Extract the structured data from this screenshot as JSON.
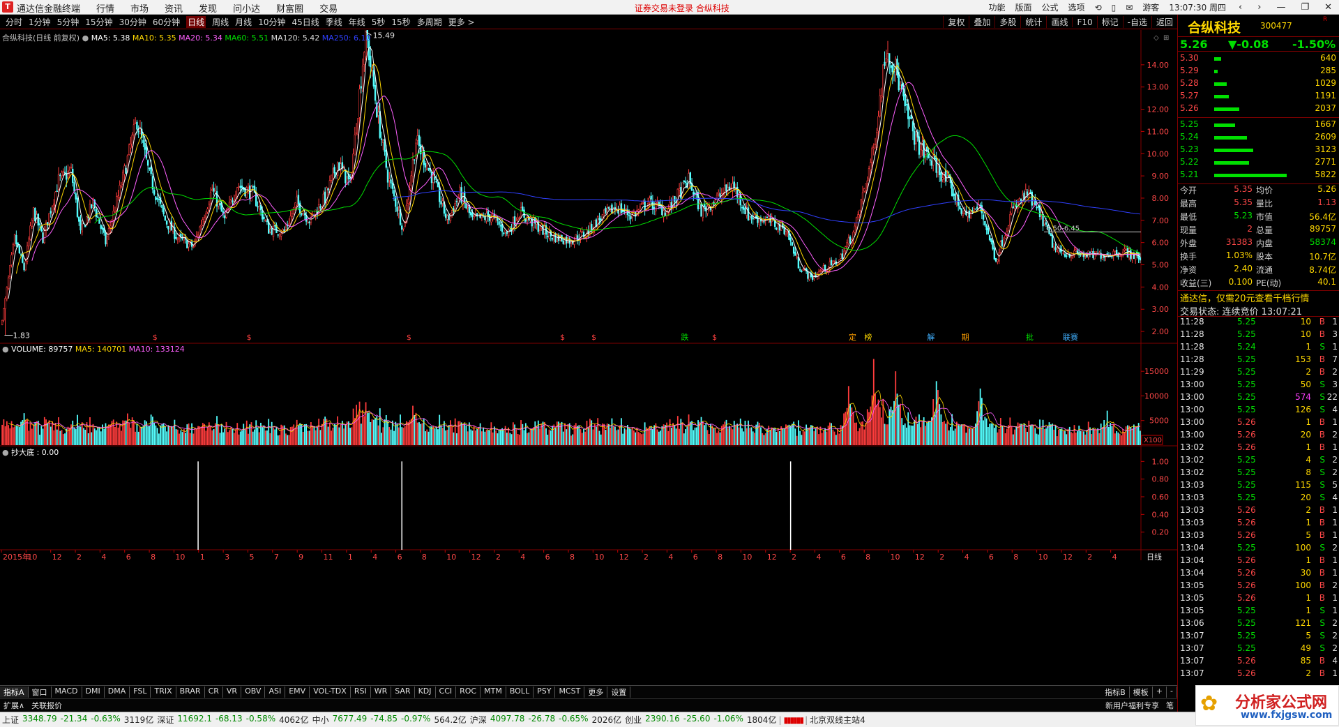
{
  "window": {
    "title": "通达信金融终端",
    "notice": "证券交易未登录  合纵科技",
    "logo_char": "T"
  },
  "menu": [
    "行情",
    "市场",
    "资讯",
    "发现",
    "问小达",
    "财富圈",
    "交易"
  ],
  "titlebar_right": [
    "功能",
    "版面",
    "公式",
    "选项",
    "游客",
    "13:07:30 周四"
  ],
  "periods": [
    "分时",
    "1分钟",
    "5分钟",
    "15分钟",
    "30分钟",
    "60分钟",
    "日线",
    "周线",
    "月线",
    "10分钟",
    "45日线",
    "季线",
    "年线",
    "5秒",
    "15秒",
    "多周期",
    "更多 >"
  ],
  "active_period": "日线",
  "tools": [
    "复权",
    "叠加",
    "多股",
    "统计",
    "画线",
    "F10",
    "标记",
    "-自选",
    "返回"
  ],
  "legend_main": {
    "symbol": "合纵科技(日线 前复权)",
    "ma5": "MA5: 5.38",
    "ma10": "MA10: 5.35",
    "ma20": "MA20: 5.34",
    "ma60": "MA60: 5.51",
    "ma120": "MA120: 5.42",
    "ma250": "MA250: 6.10"
  },
  "legend_vol": {
    "vol": "VOLUME: 89757",
    "ma5": "MA5: 140701",
    "ma10": "MA10: 133124"
  },
  "legend_ind": {
    "name": "抄大底 : 0.00"
  },
  "colors": {
    "up": "#ff3c3c",
    "down": "#54ffff",
    "ma5": "#ffffff",
    "ma10": "#ffd800",
    "ma20": "#ff60ff",
    "ma60": "#00e000",
    "ma250": "#3040ff",
    "grid": "#800000",
    "panel_border": "#800000"
  },
  "chart_data": [
    {
      "type": "candlestick",
      "title": "合纵科技(日线 前复权)",
      "y_ticks": [
        2.0,
        3.0,
        4.0,
        5.0,
        6.0,
        7.0,
        8.0,
        9.0,
        10.0,
        11.0,
        12.0,
        13.0,
        14.0
      ],
      "ylim": [
        1.5,
        15.0
      ],
      "high_label": "15.49",
      "low_label": "1.83",
      "annotation": "6.50-6.45",
      "close_path": [
        [
          0,
          2.5
        ],
        [
          8,
          6.2
        ],
        [
          14,
          4.8
        ],
        [
          20,
          7.4
        ],
        [
          26,
          6.2
        ],
        [
          36,
          8.8
        ],
        [
          44,
          9.2
        ],
        [
          50,
          6.4
        ],
        [
          58,
          7.8
        ],
        [
          66,
          6.0
        ],
        [
          76,
          8.6
        ],
        [
          86,
          11.5
        ],
        [
          94,
          9.0
        ],
        [
          104,
          7.0
        ],
        [
          112,
          6.2
        ],
        [
          122,
          5.8
        ],
        [
          134,
          8.4
        ],
        [
          142,
          7.0
        ],
        [
          150,
          8.6
        ],
        [
          160,
          8.2
        ],
        [
          170,
          6.6
        ],
        [
          180,
          6.5
        ],
        [
          188,
          7.8
        ],
        [
          196,
          7.0
        ],
        [
          206,
          8.0
        ],
        [
          214,
          9.6
        ],
        [
          222,
          8.6
        ],
        [
          232,
          15.49
        ],
        [
          240,
          11.5
        ],
        [
          246,
          9.0
        ],
        [
          256,
          6.6
        ],
        [
          264,
          10.6
        ],
        [
          274,
          9.0
        ],
        [
          284,
          7.0
        ],
        [
          292,
          8.2
        ],
        [
          300,
          7.0
        ],
        [
          312,
          7.2
        ],
        [
          322,
          6.4
        ],
        [
          330,
          7.4
        ],
        [
          340,
          6.8
        ],
        [
          350,
          6.3
        ],
        [
          362,
          6.1
        ],
        [
          372,
          6.4
        ],
        [
          380,
          7.0
        ],
        [
          392,
          7.6
        ],
        [
          402,
          7.2
        ],
        [
          412,
          7.8
        ],
        [
          424,
          7.4
        ],
        [
          438,
          8.8
        ],
        [
          446,
          7.4
        ],
        [
          456,
          8.0
        ],
        [
          466,
          8.6
        ],
        [
          476,
          7.2
        ],
        [
          488,
          7.0
        ],
        [
          500,
          6.6
        ],
        [
          508,
          5.0
        ],
        [
          516,
          4.4
        ],
        [
          524,
          4.8
        ],
        [
          534,
          5.2
        ],
        [
          544,
          6.6
        ],
        [
          556,
          10.2
        ],
        [
          564,
          14.8
        ],
        [
          570,
          13.8
        ],
        [
          576,
          12.0
        ],
        [
          584,
          10.4
        ],
        [
          594,
          9.6
        ],
        [
          604,
          8.6
        ],
        [
          614,
          7.2
        ],
        [
          624,
          7.6
        ],
        [
          634,
          5.2
        ],
        [
          644,
          7.4
        ],
        [
          654,
          8.2
        ],
        [
          664,
          7.0
        ],
        [
          672,
          5.6
        ],
        [
          684,
          5.5
        ],
        [
          696,
          5.4
        ],
        [
          706,
          5.5
        ],
        [
          716,
          5.6
        ],
        [
          726,
          5.3
        ]
      ]
    },
    {
      "type": "bar",
      "title": "VOLUME",
      "y_ticks": [
        5000,
        10000,
        15000
      ],
      "ylim": [
        0,
        18000
      ],
      "unit_label": "X100",
      "spikes": [
        [
          14,
          6500
        ],
        [
          95,
          6200
        ],
        [
          226,
          8200
        ],
        [
          262,
          8000
        ],
        [
          540,
          12000
        ],
        [
          556,
          17500
        ],
        [
          570,
          15000
        ],
        [
          596,
          13000
        ],
        [
          624,
          11500
        ],
        [
          705,
          7000
        ]
      ]
    },
    {
      "type": "line",
      "title": "抄大底",
      "y_ticks": [
        0.2,
        0.4,
        0.6,
        0.8,
        1.0
      ],
      "ylim": [
        0,
        1.05
      ],
      "signals": [
        125,
        255,
        503
      ]
    }
  ],
  "x_axis": {
    "labels": [
      "2015年",
      "10",
      "12",
      "2",
      "4",
      "6",
      "8",
      "10",
      "1",
      "3",
      "5",
      "7",
      "9",
      "11",
      "1",
      "4",
      "6",
      "8",
      "10",
      "12",
      "2",
      "4",
      "6",
      "8",
      "10",
      "12",
      "2",
      "4",
      "6",
      "8",
      "10",
      "12",
      "2",
      "4",
      "6",
      "8",
      "10",
      "12",
      "2",
      "4",
      "6",
      "8",
      "10",
      "12",
      "2",
      "4"
    ],
    "period_label": "日线"
  },
  "event_marks": [
    {
      "x": 98,
      "text": "$",
      "c": "#ff4040"
    },
    {
      "x": 158,
      "text": "$",
      "c": "#ff4040"
    },
    {
      "x": 260,
      "text": "$",
      "c": "#ff4040"
    },
    {
      "x": 358,
      "text": "$",
      "c": "#ff4040"
    },
    {
      "x": 378,
      "text": "$",
      "c": "#ff4040"
    },
    {
      "x": 436,
      "text": "跌",
      "c": "#00e000"
    },
    {
      "x": 455,
      "text": "$",
      "c": "#ff4040"
    },
    {
      "x": 543,
      "text": "定",
      "c": "#ffa000"
    },
    {
      "x": 553,
      "text": "榜",
      "c": "#ffd800"
    },
    {
      "x": 593,
      "text": "解",
      "c": "#40b0ff"
    },
    {
      "x": 615,
      "text": "期",
      "c": "#ffa000"
    },
    {
      "x": 656,
      "text": "批",
      "c": "#00e000"
    },
    {
      "x": 682,
      "text": "联赛",
      "c": "#40b0ff"
    }
  ],
  "quote": {
    "name": "合纵科技",
    "code": "300477",
    "r_mark": "R",
    "price": "5.26",
    "change": "▼-0.08",
    "pct": "-1.50%"
  },
  "asks": [
    {
      "p": "5.30",
      "v": "640",
      "w": 10
    },
    {
      "p": "5.29",
      "v": "285",
      "w": 5
    },
    {
      "p": "5.28",
      "v": "1029",
      "w": 18
    },
    {
      "p": "5.27",
      "v": "1191",
      "w": 21
    },
    {
      "p": "5.26",
      "v": "2037",
      "w": 36
    }
  ],
  "bids": [
    {
      "p": "5.25",
      "v": "1667",
      "w": 30
    },
    {
      "p": "5.24",
      "v": "2609",
      "w": 47
    },
    {
      "p": "5.23",
      "v": "3123",
      "w": 56
    },
    {
      "p": "5.22",
      "v": "2771",
      "w": 50
    },
    {
      "p": "5.21",
      "v": "5822",
      "w": 104
    }
  ],
  "stats": [
    {
      "l1": "今开",
      "v1": "5.35",
      "c1": "red",
      "l2": "均价",
      "v2": "5.26",
      "c2": "yellow"
    },
    {
      "l1": "最高",
      "v1": "5.35",
      "c1": "red",
      "l2": "量比",
      "v2": "1.13",
      "c2": "red"
    },
    {
      "l1": "最低",
      "v1": "5.23",
      "c1": "green",
      "l2": "市值",
      "v2": "56.4亿",
      "c2": "yellow"
    },
    {
      "l1": "现量",
      "v1": "2",
      "c1": "red",
      "l2": "总量",
      "v2": "89757",
      "c2": "yellow"
    },
    {
      "l1": "外盘",
      "v1": "31383",
      "c1": "red",
      "l2": "内盘",
      "v2": "58374",
      "c2": "green"
    },
    {
      "l1": "换手",
      "v1": "1.03%",
      "c1": "yellow",
      "l2": "股本",
      "v2": "10.7亿",
      "c2": "yellow"
    },
    {
      "l1": "净资",
      "v1": "2.40",
      "c1": "yellow",
      "l2": "流通",
      "v2": "8.74亿",
      "c2": "yellow"
    },
    {
      "l1": "收益(三)",
      "v1": "0.100",
      "c1": "yellow",
      "l2": "PE(动)",
      "v2": "40.1",
      "c2": "yellow"
    }
  ],
  "notice_line": "通达信，仅需20元查看千档行情",
  "trade_status": "交易状态: 连续竞价 13:07:21",
  "ticks": [
    {
      "t": "11:28",
      "p": "5.25",
      "v": "10",
      "d": "B",
      "n": "1"
    },
    {
      "t": "11:28",
      "p": "5.25",
      "v": "10",
      "d": "B",
      "n": "3"
    },
    {
      "t": "11:28",
      "p": "5.24",
      "v": "1",
      "d": "S",
      "n": "1"
    },
    {
      "t": "11:28",
      "p": "5.25",
      "v": "153",
      "d": "B",
      "n": "7"
    },
    {
      "t": "11:29",
      "p": "5.25",
      "v": "2",
      "d": "B",
      "n": "2"
    },
    {
      "t": "13:00",
      "p": "5.25",
      "v": "50",
      "d": "S",
      "n": "3"
    },
    {
      "t": "13:00",
      "p": "5.25",
      "v": "574",
      "d": "S",
      "n": "22"
    },
    {
      "t": "13:00",
      "p": "5.25",
      "v": "126",
      "d": "S",
      "n": "4"
    },
    {
      "t": "13:00",
      "p": "5.26",
      "v": "1",
      "d": "B",
      "n": "1"
    },
    {
      "t": "13:00",
      "p": "5.26",
      "v": "20",
      "d": "B",
      "n": "2"
    },
    {
      "t": "13:02",
      "p": "5.26",
      "v": "1",
      "d": "B",
      "n": "1"
    },
    {
      "t": "13:02",
      "p": "5.25",
      "v": "4",
      "d": "S",
      "n": "2"
    },
    {
      "t": "13:02",
      "p": "5.25",
      "v": "8",
      "d": "S",
      "n": "2"
    },
    {
      "t": "13:03",
      "p": "5.25",
      "v": "115",
      "d": "S",
      "n": "5"
    },
    {
      "t": "13:03",
      "p": "5.25",
      "v": "20",
      "d": "S",
      "n": "4"
    },
    {
      "t": "13:03",
      "p": "5.26",
      "v": "2",
      "d": "B",
      "n": "1"
    },
    {
      "t": "13:03",
      "p": "5.26",
      "v": "1",
      "d": "B",
      "n": "1"
    },
    {
      "t": "13:03",
      "p": "5.26",
      "v": "5",
      "d": "B",
      "n": "1"
    },
    {
      "t": "13:04",
      "p": "5.25",
      "v": "100",
      "d": "S",
      "n": "2"
    },
    {
      "t": "13:04",
      "p": "5.26",
      "v": "1",
      "d": "B",
      "n": "1"
    },
    {
      "t": "13:04",
      "p": "5.26",
      "v": "30",
      "d": "B",
      "n": "1"
    },
    {
      "t": "13:05",
      "p": "5.26",
      "v": "100",
      "d": "B",
      "n": "2"
    },
    {
      "t": "13:05",
      "p": "5.26",
      "v": "1",
      "d": "B",
      "n": "1"
    },
    {
      "t": "13:05",
      "p": "5.25",
      "v": "1",
      "d": "S",
      "n": "1"
    },
    {
      "t": "13:06",
      "p": "5.25",
      "v": "121",
      "d": "S",
      "n": "2"
    },
    {
      "t": "13:07",
      "p": "5.25",
      "v": "5",
      "d": "S",
      "n": "2"
    },
    {
      "t": "13:07",
      "p": "5.25",
      "v": "49",
      "d": "S",
      "n": "2"
    },
    {
      "t": "13:07",
      "p": "5.26",
      "v": "85",
      "d": "B",
      "n": "4"
    },
    {
      "t": "13:07",
      "p": "5.26",
      "v": "2",
      "d": "B",
      "n": "1"
    }
  ],
  "indicators": [
    "指标A",
    "窗口",
    "MACD",
    "DMI",
    "DMA",
    "FSL",
    "TRIX",
    "BRAR",
    "CR",
    "VR",
    "OBV",
    "ASI",
    "EMV",
    "VOL-TDX",
    "RSI",
    "WR",
    "SAR",
    "KDJ",
    "CCI",
    "ROC",
    "MTM",
    "BOLL",
    "PSY",
    "MCST",
    "更多",
    "设置"
  ],
  "indicators_right": [
    "指标B",
    "模板",
    "+",
    "-"
  ],
  "ext": [
    "扩展∧",
    "关联报价"
  ],
  "ext_right": [
    "新用户福利专享",
    "笔"
  ],
  "status": [
    {
      "name": "上证",
      "val": "3348.79",
      "chg": "-21.34",
      "pct": "-0.63%",
      "amt": "3119亿"
    },
    {
      "name": "深证",
      "val": "11692.1",
      "chg": "-68.13",
      "pct": "-0.58%",
      "amt": "4062亿"
    },
    {
      "name": "中小",
      "val": "7677.49",
      "chg": "-74.85",
      "pct": "-0.97%",
      "amt": "564.2亿"
    },
    {
      "name": "沪深",
      "val": "4097.78",
      "chg": "-26.78",
      "pct": "-0.65%",
      "amt": "2026亿"
    },
    {
      "name": "创业",
      "val": "2390.16",
      "chg": "-25.60",
      "pct": "-1.06%",
      "amt": "1804亿"
    }
  ],
  "server": "北京双线主站4",
  "watermark": {
    "line1": "分析家公式网",
    "line2": "www.fxjgsw.com"
  }
}
